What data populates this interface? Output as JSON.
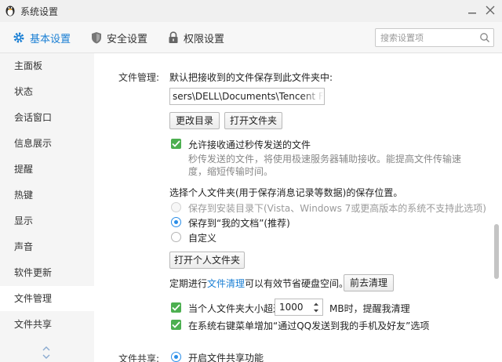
{
  "window": {
    "title": "系统设置"
  },
  "tabs": [
    {
      "label": "基本设置",
      "icon": "gear-icon",
      "active": true
    },
    {
      "label": "安全设置",
      "icon": "shield-icon"
    },
    {
      "label": "权限设置",
      "icon": "lock-icon"
    }
  ],
  "search": {
    "placeholder": "搜索设置项",
    "value": ""
  },
  "sidebar": {
    "items": [
      "主面板",
      "状态",
      "会话窗口",
      "信息展示",
      "提醒",
      "热键",
      "显示",
      "声音",
      "软件更新",
      "文件管理",
      "文件共享"
    ],
    "active": "文件管理"
  },
  "file_management": {
    "label": "文件管理:",
    "save_location_text": "默认把接收到的文件保存到此文件夹中:",
    "path": "sers\\DELL\\Documents\\Tencent Files",
    "change_dir_button": "更改目录",
    "open_folder_button": "打开文件夹",
    "allow_flash_transfer": {
      "label": "允许接收通过秒传发送的文件",
      "checked": true
    },
    "flash_desc_line1": "秒传发送的文件，将使用极速服务器辅助接收。能提高文件传输速",
    "flash_desc_line2": "度，缩短传输时间。",
    "personal_folder_text": "选择个人文件夹(用于保存消息记录等数据)的保存位置。",
    "options": [
      {
        "label": "保存到安装目录下(Vista、Windows 7或更高版本的系统不支持此选项)",
        "state": "disabled"
      },
      {
        "label": "保存到“我的文档”(推荐)",
        "state": "checked"
      },
      {
        "label": "自定义",
        "state": "unchecked"
      }
    ],
    "open_personal_button": "打开个人文件夹",
    "cleanup_prefix": "定期进行",
    "cleanup_link": "文件清理",
    "cleanup_suffix": "可以有效节省硬盘空间。",
    "cleanup_button": "前去清理",
    "size_reminder": {
      "prefix": "当个人文件夹大小超过",
      "value": "1000",
      "suffix": "MB时，提醒我清理",
      "checked": true
    },
    "context_menu": {
      "label": "在系统右键菜单增加“通过QQ发送到我的手机及好友”选项",
      "checked": true
    }
  },
  "file_sharing": {
    "label": "文件共享:",
    "enable_label": "开启文件共享功能",
    "enabled": true
  },
  "colors": {
    "accent": "#1a7fd4",
    "check_green": "#4caf50",
    "radio_blue": "#2a8ee8"
  }
}
